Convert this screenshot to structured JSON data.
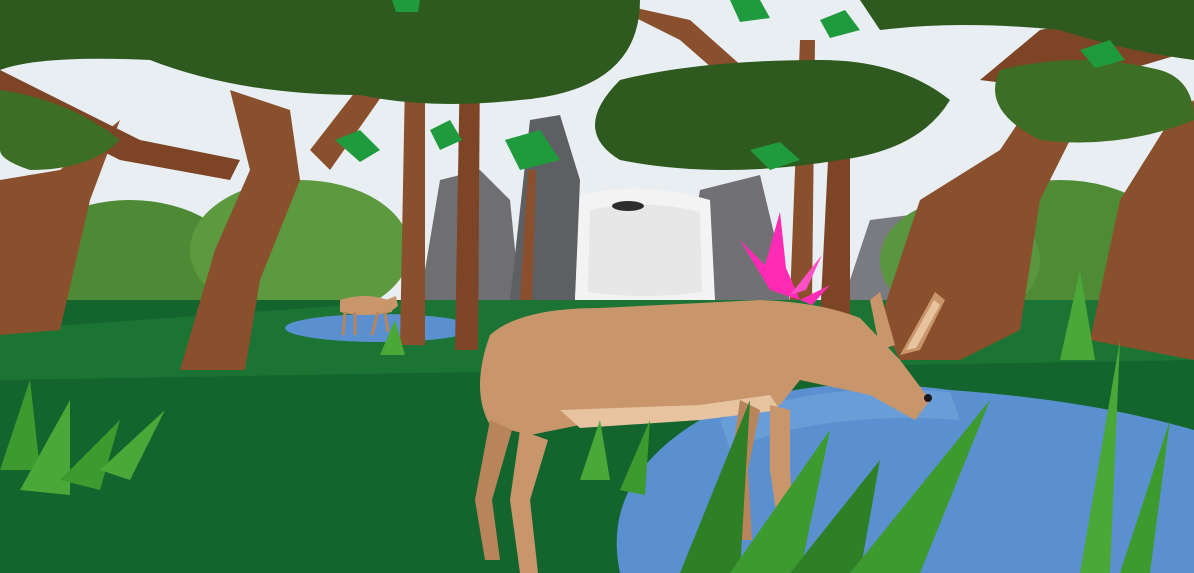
{
  "scene": {
    "colors": {
      "sky": "#e9eef2",
      "canopy_dark": "#2f5a1f",
      "canopy_mid": "#3c6e26",
      "leaf_bright": "#1f9a3c",
      "trunk": "#8a4f2c",
      "trunk_shadow": "#6b3a1f",
      "ground": "#13652d",
      "ground_light": "#2a8a3a",
      "water": "#5a90cf",
      "rock": "#6f6f73",
      "waterfall": "#f1f1f1",
      "deer": "#c9966c",
      "deer_light": "#e7c3a0",
      "grass": "#3d9a2f",
      "flower": "#ff2bb5"
    },
    "icons": [
      "deer-foreground",
      "deer-background",
      "waterfall",
      "pink-flower",
      "trees",
      "pond",
      "rocks",
      "grass"
    ]
  }
}
